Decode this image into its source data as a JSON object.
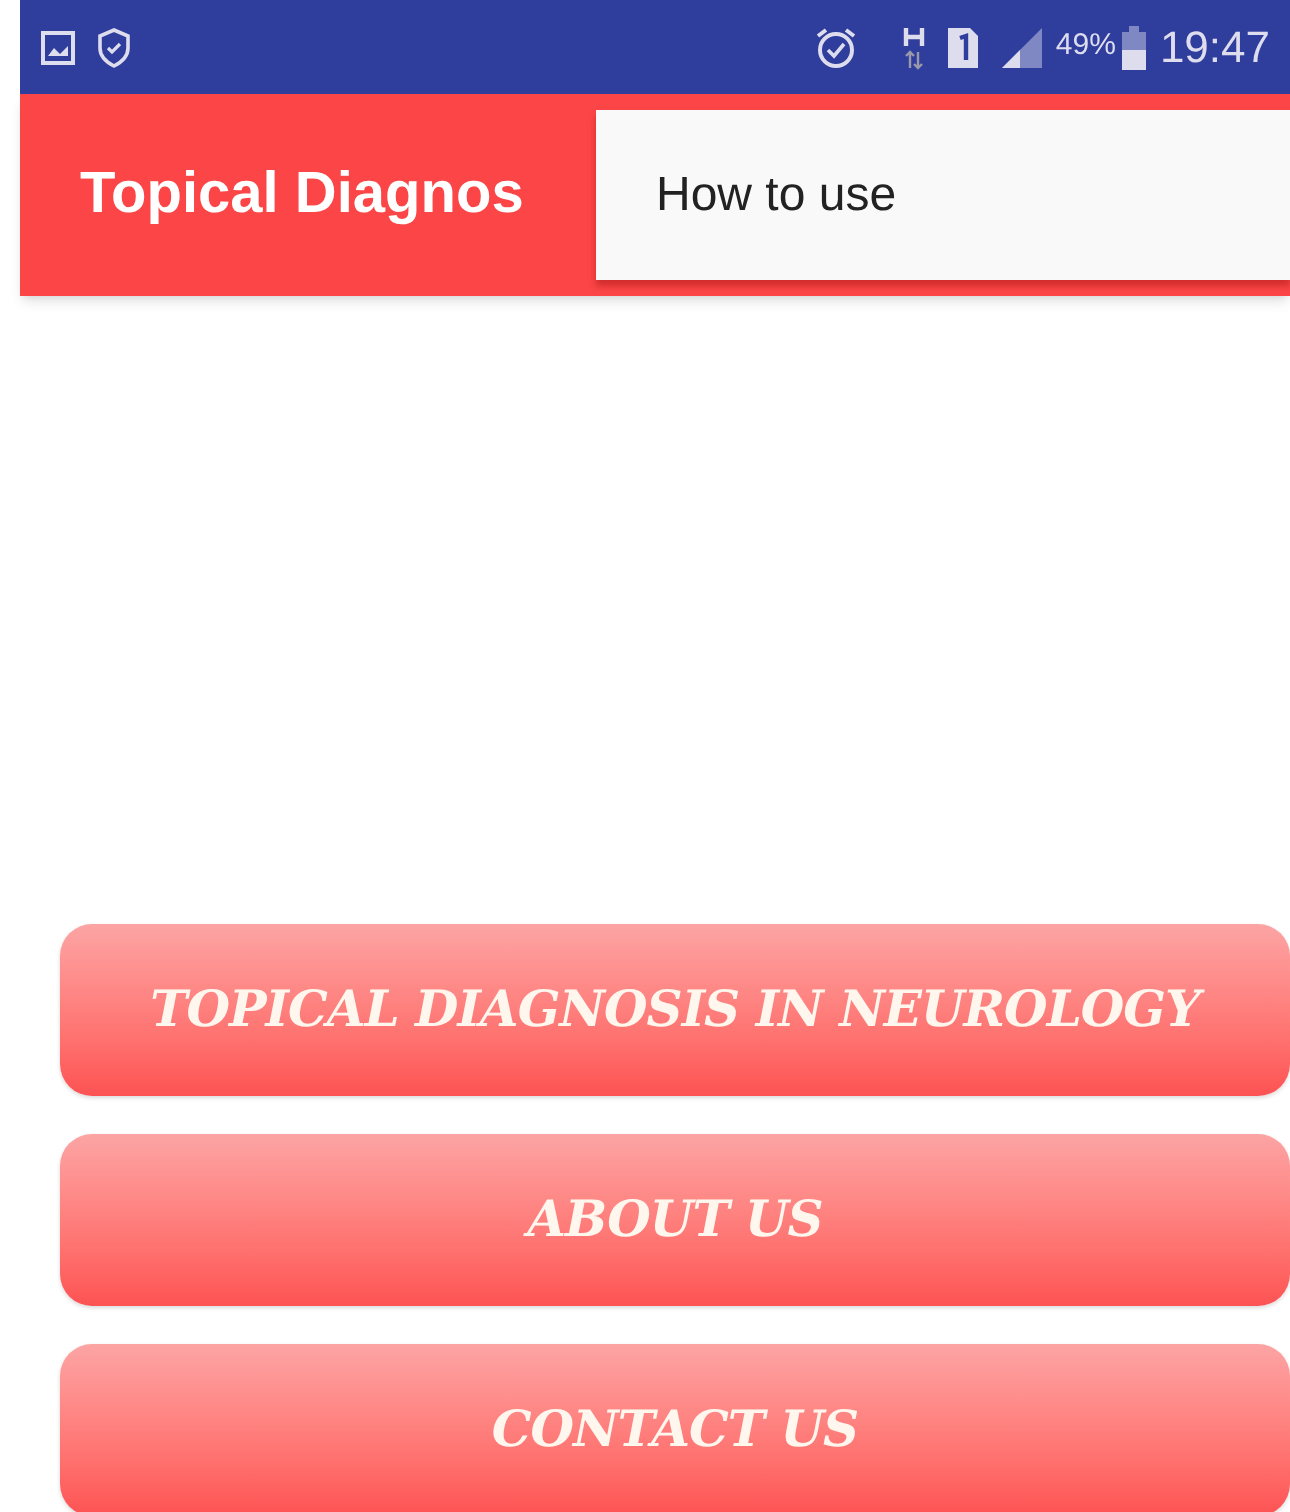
{
  "status_bar": {
    "battery": "49%",
    "time": "19:47"
  },
  "app_bar": {
    "title": "Topical Diagnos"
  },
  "overflow_menu": {
    "items": [
      "How to use"
    ]
  },
  "buttons": [
    "TOPICAL DIAGNOSIS IN NEUROLOGY",
    "ABOUT US",
    "CONTACT US"
  ]
}
